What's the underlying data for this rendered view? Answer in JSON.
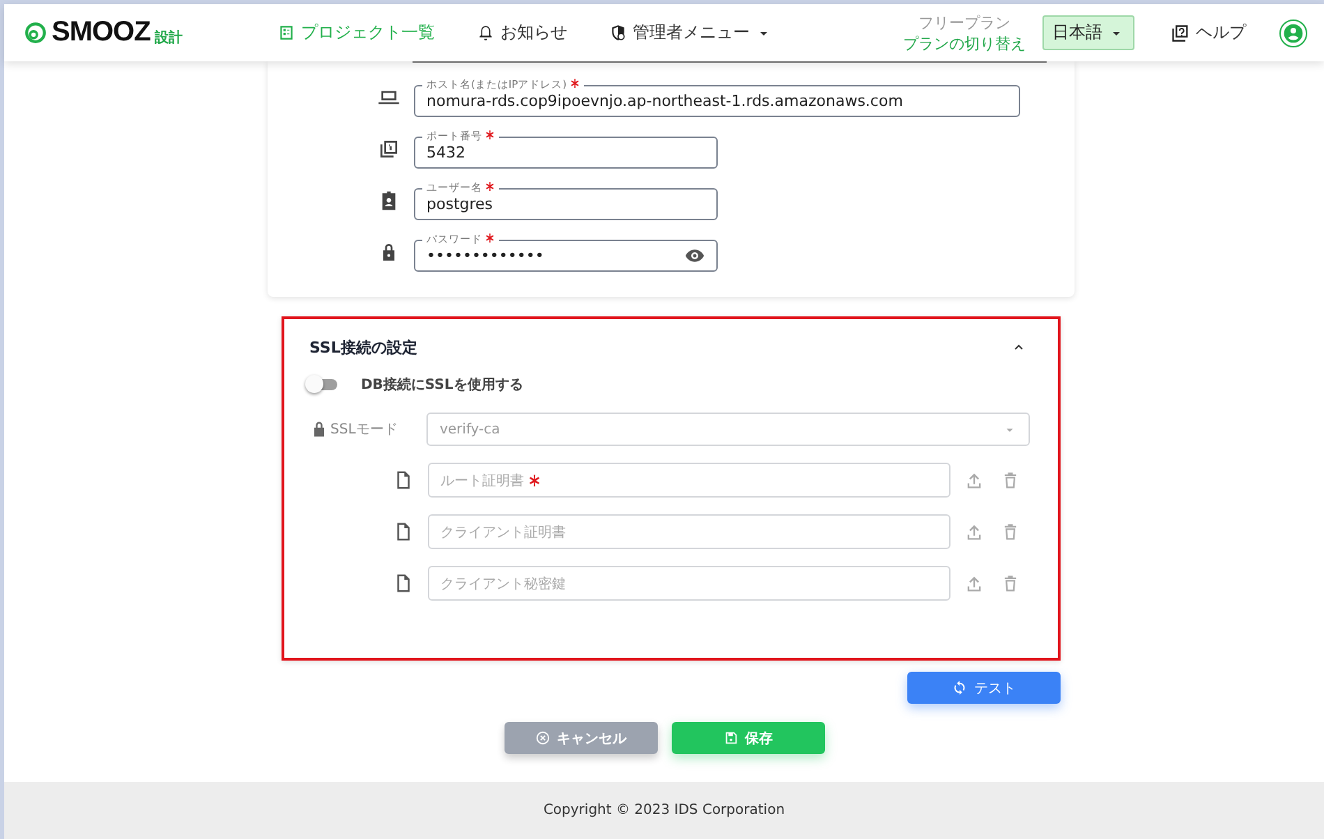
{
  "header": {
    "logo": "SMOOZ",
    "logo_suffix": "設計",
    "nav": [
      {
        "label": "プロジェクト一覧",
        "selected": true,
        "kind": "list"
      },
      {
        "label": "お知らせ",
        "selected": false,
        "kind": "bell"
      },
      {
        "label": "管理者メニュー",
        "selected": false,
        "kind": "admin"
      }
    ],
    "plan": "フリープラン",
    "plan_link": "プランの切り替え",
    "language": "日本語",
    "help": "ヘルプ"
  },
  "connection": {
    "fields": [
      {
        "label": "ホスト名(またはIPアドレス)",
        "required": true,
        "value": "nomura-rds.cop9ipoevnjo.ap-northeast-1.rds.amazonaws.com",
        "kind": "host"
      },
      {
        "label": "ポート番号",
        "required": true,
        "value": "5432",
        "kind": "port"
      },
      {
        "label": "ユーザー名",
        "required": true,
        "value": "postgres",
        "kind": "user"
      },
      {
        "label": "パスワード",
        "required": true,
        "value": "•••••••••••••",
        "kind": "password"
      }
    ]
  },
  "ssl": {
    "title": "SSL接続の設定",
    "expanded": true,
    "toggle_label": "DB接続にSSLを使用する",
    "enabled": false,
    "mode_label": "SSLモード",
    "mode_value": "verify-ca",
    "files": [
      {
        "placeholder": "ルート証明書",
        "required": true
      },
      {
        "placeholder": "クライアント証明書",
        "required": false
      },
      {
        "placeholder": "クライアント秘密鍵",
        "required": false
      }
    ]
  },
  "test_button": "テスト",
  "buttons": [
    {
      "label": "キャンセル",
      "kind": "cancel"
    },
    {
      "label": "保存",
      "kind": "save"
    }
  ],
  "footer": "Copyright © 2023 IDS Corporation"
}
